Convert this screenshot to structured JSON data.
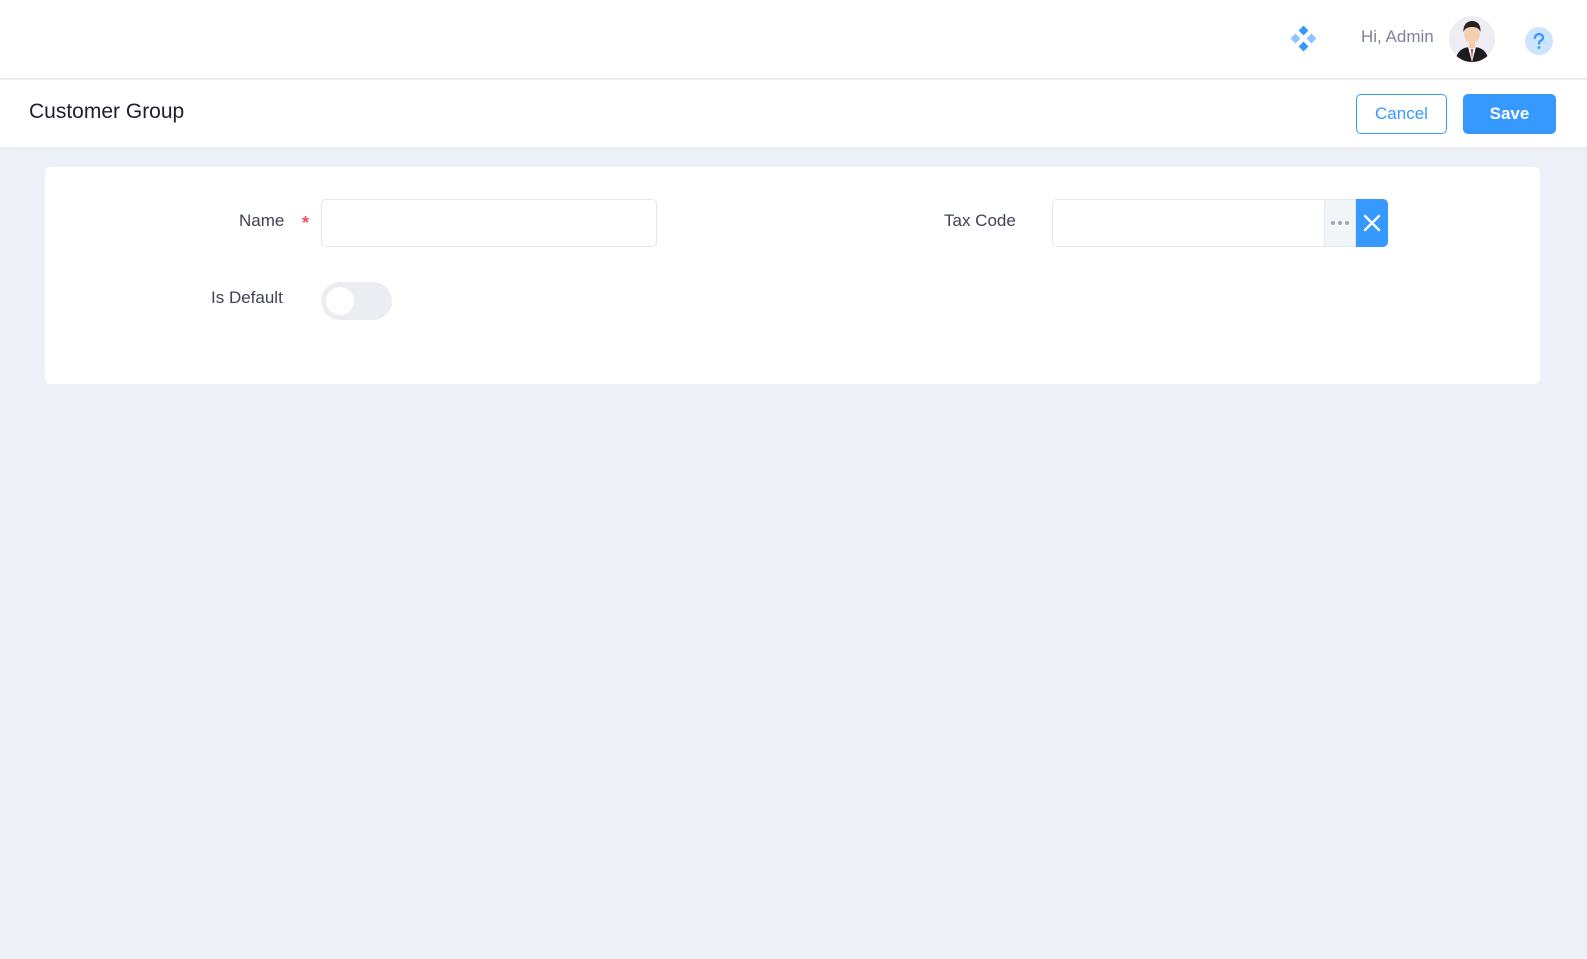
{
  "header": {
    "greeting": "Hi, Admin",
    "apps_icon": "apps-diamond-icon",
    "avatar": "user-avatar",
    "help_icon": "help-question-icon",
    "accent_color": "#3699ff"
  },
  "page": {
    "title": "Customer Group",
    "cancel_label": "Cancel",
    "save_label": "Save"
  },
  "form": {
    "name": {
      "label": "Name",
      "required_mark": "*",
      "value": ""
    },
    "tax_code": {
      "label": "Tax Code",
      "value": "",
      "more_icon": "ellipsis-icon",
      "clear_icon": "close-icon"
    },
    "is_default": {
      "label": "Is Default",
      "checked": false
    }
  }
}
